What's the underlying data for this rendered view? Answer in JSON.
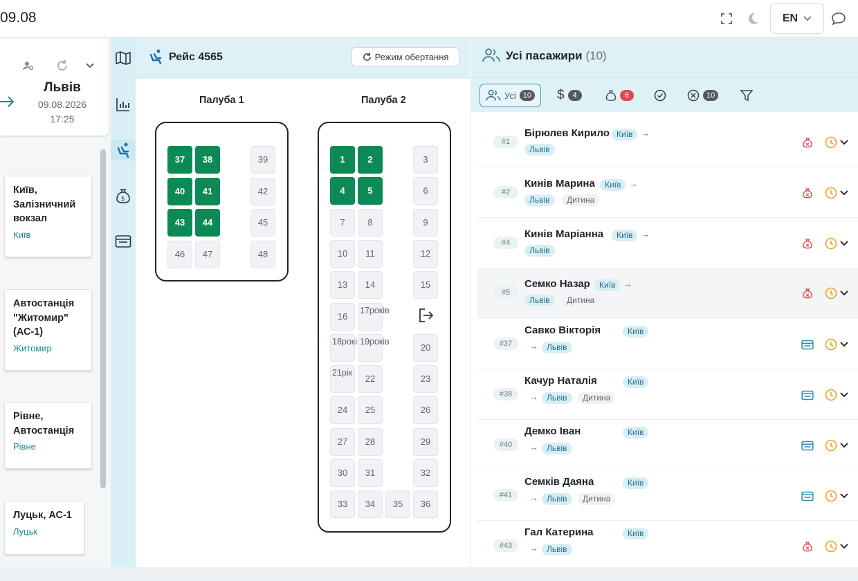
{
  "topbar": {
    "title": "09.08",
    "lang": "EN"
  },
  "route": {
    "city": "Львів",
    "date": "09.08.2026",
    "time": "17:25",
    "stops": [
      {
        "name": "Київ, Залізничний вокзал",
        "city": "Київ"
      },
      {
        "name": "Автостанція \"Житомир\" (АС-1)",
        "city": "Житомир"
      },
      {
        "name": "Рівне, Автостанція",
        "city": "Рівне"
      },
      {
        "name": "Луцьк, АС-1",
        "city": "Луцьк"
      }
    ]
  },
  "seatmap": {
    "flight": "Рейс 4565",
    "rotate_label": "Режим обертання",
    "deck1_title": "Палуба 1",
    "deck2_title": "Палуба 2",
    "deck1_seats": [
      {
        "n": "37",
        "taken": true
      },
      {
        "n": "38",
        "taken": true
      },
      {
        "n": "39",
        "taken": false
      },
      {
        "n": "40",
        "taken": true
      },
      {
        "n": "41",
        "taken": true
      },
      {
        "n": "42",
        "taken": false
      },
      {
        "n": "43",
        "taken": true
      },
      {
        "n": "44",
        "taken": true
      },
      {
        "n": "45",
        "taken": false
      },
      {
        "n": "46",
        "taken": false
      },
      {
        "n": "47",
        "taken": false
      },
      {
        "n": "48",
        "taken": false
      }
    ],
    "deck2_seats": [
      {
        "n": "1",
        "taken": true
      },
      {
        "n": "2",
        "taken": true
      },
      {
        "n": "3",
        "taken": false
      },
      {
        "n": "4",
        "taken": true
      },
      {
        "n": "5",
        "taken": true
      },
      {
        "n": "6",
        "taken": false
      },
      {
        "n": "7"
      },
      {
        "n": "8"
      },
      {
        "n": "9"
      },
      {
        "n": "10"
      },
      {
        "n": "11"
      },
      {
        "n": "12"
      },
      {
        "n": "13"
      },
      {
        "n": "14"
      },
      {
        "n": "15"
      },
      {
        "n": "16"
      },
      {
        "n": "17",
        "note": "років"
      },
      {
        "n": "18",
        "note": "років"
      },
      {
        "n": "19",
        "note": "років"
      },
      {
        "n": "20"
      },
      {
        "n": "21",
        "note": "рік"
      },
      {
        "n": "22"
      },
      {
        "n": "23"
      },
      {
        "n": "24"
      },
      {
        "n": "25"
      },
      {
        "n": "26"
      },
      {
        "n": "27"
      },
      {
        "n": "28"
      },
      {
        "n": "29"
      },
      {
        "n": "30"
      },
      {
        "n": "31"
      },
      {
        "n": "32"
      },
      {
        "n": "33"
      },
      {
        "n": "34"
      },
      {
        "n": "35"
      },
      {
        "n": "36"
      }
    ]
  },
  "passengers": {
    "title": "Усі пасажири",
    "count": "(10)",
    "filters": {
      "all_label": "Усі",
      "all_count": "10",
      "paid_count": "4",
      "money_count": "6",
      "cancel_count": "10"
    },
    "rows": [
      {
        "num": "#1",
        "name": "Бірюлев Кирило",
        "from": "Київ",
        "to": "Львів",
        "extra": "",
        "pay": "money",
        "hl": false,
        "layout": "a"
      },
      {
        "num": "#2",
        "name": "Кинів Марина",
        "from": "Київ",
        "to": "Львів",
        "extra": "Дитина",
        "pay": "money",
        "hl": false,
        "layout": "a"
      },
      {
        "num": "#4",
        "name": "Кинів Маріанна",
        "from": "Київ",
        "to": "Львів",
        "extra": "",
        "pay": "money",
        "hl": false,
        "layout": "a"
      },
      {
        "num": "#5",
        "name": "Семко Назар",
        "from": "Київ",
        "to": "Львів",
        "extra": "Дитина",
        "pay": "money",
        "hl": true,
        "layout": "a"
      },
      {
        "num": "#37",
        "name": "Савко Вікторія",
        "from": "Київ",
        "to": "Львів",
        "extra": "",
        "pay": "card",
        "hl": false,
        "layout": "b"
      },
      {
        "num": "#38",
        "name": "Качур Наталія",
        "from": "Київ",
        "to": "Львів",
        "extra": "Дитина",
        "pay": "card",
        "hl": false,
        "layout": "b"
      },
      {
        "num": "#40",
        "name": "Демко Іван",
        "from": "Київ",
        "to": "Львів",
        "extra": "",
        "pay": "card",
        "hl": false,
        "layout": "b"
      },
      {
        "num": "#41",
        "name": "Семків Даяна",
        "from": "Київ",
        "to": "Львів",
        "extra": "Дитина",
        "pay": "card",
        "hl": false,
        "layout": "b"
      },
      {
        "num": "#43",
        "name": "Гал Катерина",
        "from": "Київ",
        "to": "Львів",
        "extra": "",
        "pay": "money",
        "hl": false,
        "layout": "b"
      }
    ]
  },
  "colors": {
    "accent": "#1a8f8a",
    "seat_taken": "#0b8a55",
    "header_bg": "#ddf1f7",
    "money_red": "#e0474c",
    "clock_orange": "#f0a21a",
    "card_teal": "#2a8fb0"
  }
}
